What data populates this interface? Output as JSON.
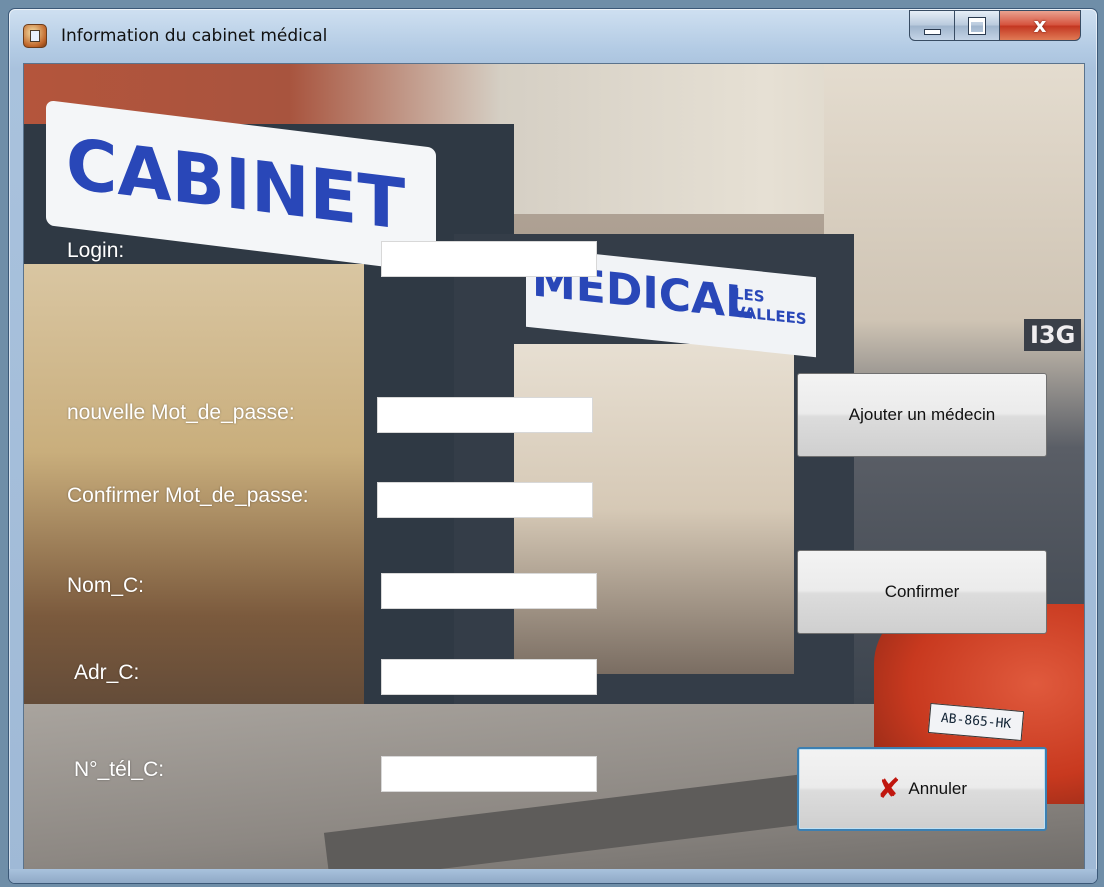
{
  "window": {
    "title": "Information du cabinet médical",
    "close_glyph": "x"
  },
  "background": {
    "sign_cabinet": "CABINET",
    "sign_medical": "MEDICAL",
    "sign_les": "LES",
    "sign_vallees": "VALLEES",
    "sign_i3g": "I3G",
    "plate": "AB-865-HK"
  },
  "form": {
    "login_label": "Login:",
    "login_value": "",
    "new_password_label": "nouvelle Mot_de_passe:",
    "new_password_value": "",
    "confirm_password_label": "Confirmer Mot_de_passe:",
    "confirm_password_value": "",
    "nom_label": "Nom_C:",
    "nom_value": "",
    "adr_label": "Adr_C:",
    "adr_value": "",
    "tel_label": "N°_tél_C:",
    "tel_value": ""
  },
  "buttons": {
    "add_doctor": "Ajouter un médecin",
    "confirm": "Confirmer",
    "cancel": "Annuler",
    "cancel_icon": "x-icon",
    "cancel_icon_color": "#c0160e"
  }
}
